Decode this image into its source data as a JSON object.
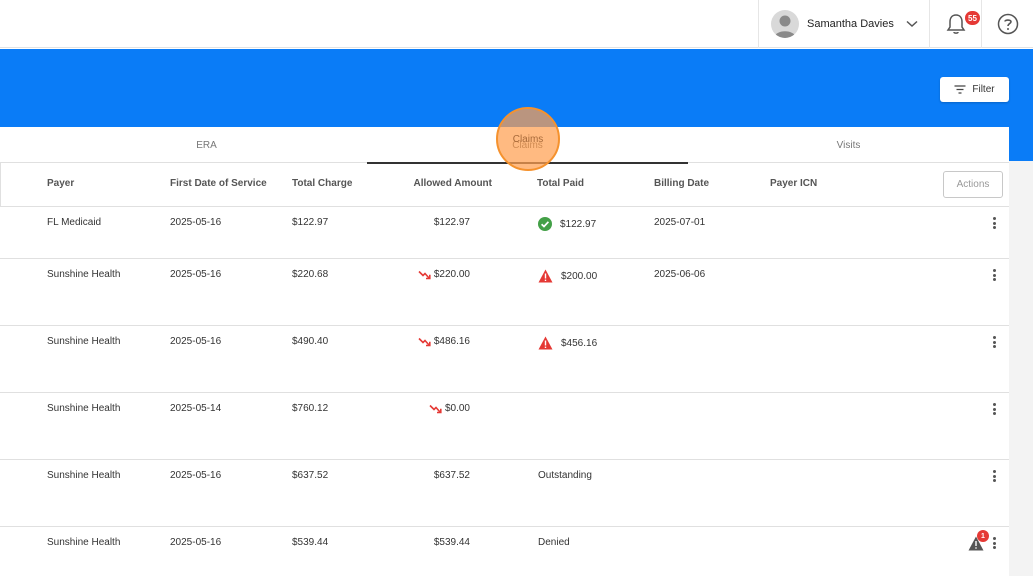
{
  "header": {
    "user_name": "Samantha Davies",
    "notification_count": "55"
  },
  "banner": {
    "filter_label": "Filter",
    "color": "#0a7cf7"
  },
  "tabs": [
    {
      "label": "ERA"
    },
    {
      "label": "Claims",
      "active": true
    },
    {
      "label": "Visits"
    }
  ],
  "table": {
    "columns": {
      "payer": "Payer",
      "first_date": "First Date of Service",
      "total_charge": "Total Charge",
      "allowed_amount": "Allowed Amount",
      "total_paid": "Total Paid",
      "billing_date": "Billing Date",
      "payer_icn": "Payer ICN"
    },
    "actions_label": "Actions",
    "rows": [
      {
        "payer": "FL Medicaid",
        "first_date": "2025-05-16",
        "total_charge": "$122.97",
        "allowed_amount": "$122.97",
        "allowed_trend": false,
        "total_paid": "$122.97",
        "paid_status": "ok",
        "billing_date": "2025-07-01",
        "payer_icn": "",
        "flag_count": ""
      },
      {
        "payer": "Sunshine Health",
        "first_date": "2025-05-16",
        "total_charge": "$220.68",
        "allowed_amount": "$220.00",
        "allowed_trend": true,
        "total_paid": "$200.00",
        "paid_status": "warning",
        "billing_date": "2025-06-06",
        "payer_icn": "",
        "flag_count": ""
      },
      {
        "payer": "Sunshine Health",
        "first_date": "2025-05-16",
        "total_charge": "$490.40",
        "allowed_amount": "$486.16",
        "allowed_trend": true,
        "total_paid": "$456.16",
        "paid_status": "warning",
        "billing_date": "",
        "payer_icn": "",
        "flag_count": ""
      },
      {
        "payer": "Sunshine Health",
        "first_date": "2025-05-14",
        "total_charge": "$760.12",
        "allowed_amount": "$0.00",
        "allowed_trend": true,
        "total_paid": "",
        "paid_status": "none",
        "billing_date": "",
        "payer_icn": "",
        "flag_count": ""
      },
      {
        "payer": "Sunshine Health",
        "first_date": "2025-05-16",
        "total_charge": "$637.52",
        "allowed_amount": "$637.52",
        "allowed_trend": false,
        "total_paid": "Outstanding",
        "paid_status": "none",
        "billing_date": "",
        "payer_icn": "",
        "flag_count": ""
      },
      {
        "payer": "Sunshine Health",
        "first_date": "2025-05-16",
        "total_charge": "$539.44",
        "allowed_amount": "$539.44",
        "allowed_trend": false,
        "total_paid": "Denied",
        "paid_status": "none",
        "billing_date": "",
        "payer_icn": "",
        "flag_count": "1"
      }
    ]
  },
  "colors": {
    "ok": "#43a047",
    "warning": "#e53935",
    "trend_down": "#e53935",
    "click_indicator": "#f5922e"
  }
}
